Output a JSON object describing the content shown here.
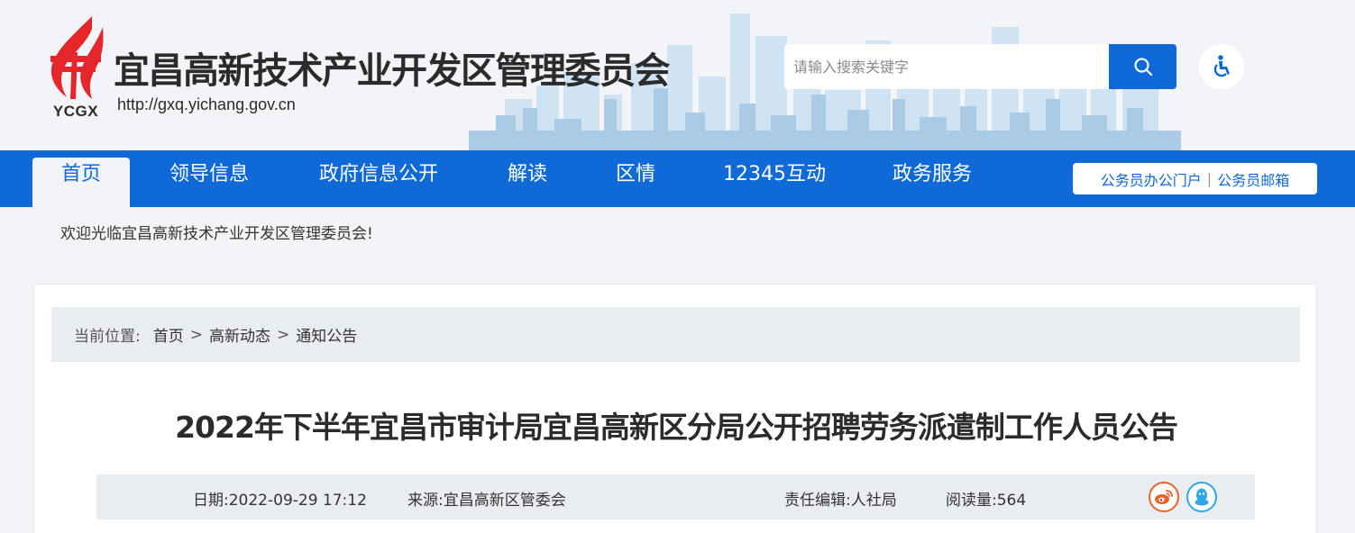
{
  "header": {
    "logo_abbr": "YCGX",
    "title": "宜昌高新技术产业开发区管理委员会",
    "url": "http://gxq.yichang.gov.cn",
    "search_placeholder": "请输入搜索关键字",
    "search_icon": "search-icon",
    "accessibility_icon": "wheelchair-icon",
    "logo_color": "#e5262b"
  },
  "nav": {
    "items": [
      {
        "label": "首页",
        "active": true
      },
      {
        "label": "领导信息"
      },
      {
        "label": "政府信息公开"
      },
      {
        "label": "解读"
      },
      {
        "label": "区情"
      },
      {
        "label": "12345互动"
      },
      {
        "label": "政务服务"
      }
    ],
    "quick_links": [
      "公务员办公门户",
      "公务员邮箱"
    ],
    "separator": "|"
  },
  "welcome": "欢迎光临宜昌高新技术产业开发区管理委员会!",
  "breadcrumb": {
    "prefix": "当前位置:",
    "items": [
      "首页",
      "高新动态",
      "通知公告"
    ],
    "separator": ">"
  },
  "article": {
    "title": "2022年下半年宜昌市审计局宜昌高新区分局公开招聘劳务派遣制工作人员公告",
    "date": "日期:2022-09-29 17:12",
    "source": "来源:宜昌高新区管委会",
    "editor": "责任编辑:人社局",
    "views": "阅读量:564",
    "share": [
      "weibo-icon",
      "qq-icon"
    ]
  },
  "colors": {
    "accent": "#0f6ad7",
    "page_bg": "#f2f4f7",
    "weibo": "#e8632b",
    "qq": "#2ea6e8"
  }
}
